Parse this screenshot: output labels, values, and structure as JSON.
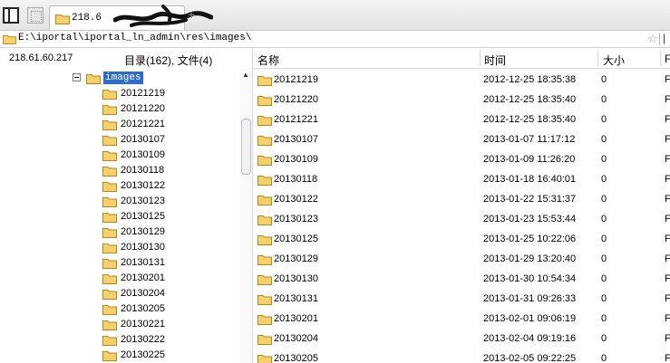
{
  "tabbar": {
    "tab_title": "218.6",
    "new_tab_label": "+"
  },
  "pathbar": {
    "path": "E:\\iportal\\iportal_ln_admin\\res\\images\\",
    "star": "☆",
    "more": "|"
  },
  "left_panel": {
    "server": "218.61.60.217",
    "dir_count": "目录(162), 文件(4)",
    "root_label": "images",
    "folders": [
      "20121219",
      "20121220",
      "20121221",
      "20130107",
      "20130109",
      "20130118",
      "20130122",
      "20130123",
      "20130125",
      "20130129",
      "20130130",
      "20130131",
      "20130201",
      "20130204",
      "20130205",
      "20130221",
      "20130222",
      "20130225"
    ]
  },
  "columns": {
    "name": "名称",
    "time": "时间",
    "size": "大小",
    "extra": "F"
  },
  "rows": [
    {
      "name": "20121219",
      "time": "2012-12-25 18:35:38",
      "size": "0",
      "extra": "F"
    },
    {
      "name": "20121220",
      "time": "2012-12-25 18:35:40",
      "size": "0",
      "extra": "F"
    },
    {
      "name": "20121221",
      "time": "2012-12-25 18:35:40",
      "size": "0",
      "extra": "F"
    },
    {
      "name": "20130107",
      "time": "2013-01-07 11:17:12",
      "size": "0",
      "extra": "F"
    },
    {
      "name": "20130109",
      "time": "2013-01-09 11:26:20",
      "size": "0",
      "extra": "F"
    },
    {
      "name": "20130118",
      "time": "2013-01-18 16:40:01",
      "size": "0",
      "extra": "F"
    },
    {
      "name": "20130122",
      "time": "2013-01-22 15:31:37",
      "size": "0",
      "extra": "F"
    },
    {
      "name": "20130123",
      "time": "2013-01-23 15:53:44",
      "size": "0",
      "extra": "F"
    },
    {
      "name": "20130125",
      "time": "2013-01-25 10:22:06",
      "size": "0",
      "extra": "F"
    },
    {
      "name": "20130129",
      "time": "2013-01-29 13:20:40",
      "size": "0",
      "extra": "F"
    },
    {
      "name": "20130130",
      "time": "2013-01-30 10:54:34",
      "size": "0",
      "extra": "F"
    },
    {
      "name": "20130131",
      "time": "2013-01-31 09:26:33",
      "size": "0",
      "extra": "F"
    },
    {
      "name": "20130201",
      "time": "2013-02-01 09:06:19",
      "size": "0",
      "extra": "F"
    },
    {
      "name": "20130204",
      "time": "2013-02-04 09:19:16",
      "size": "0",
      "extra": "F"
    },
    {
      "name": "20130205",
      "time": "2013-02-05 09:22:25",
      "size": "0",
      "extra": "F"
    }
  ],
  "icons": {
    "folder": "folder-icon",
    "tab_toggle": "panel-toggle-icon",
    "tree_collapse": "tree-collapse-icon",
    "scroll_up": "scroll-up-arrow-icon"
  },
  "colors": {
    "selection": "#2d6ccc",
    "folder_fill": "#f6d06a",
    "folder_stroke": "#b08a1e"
  }
}
